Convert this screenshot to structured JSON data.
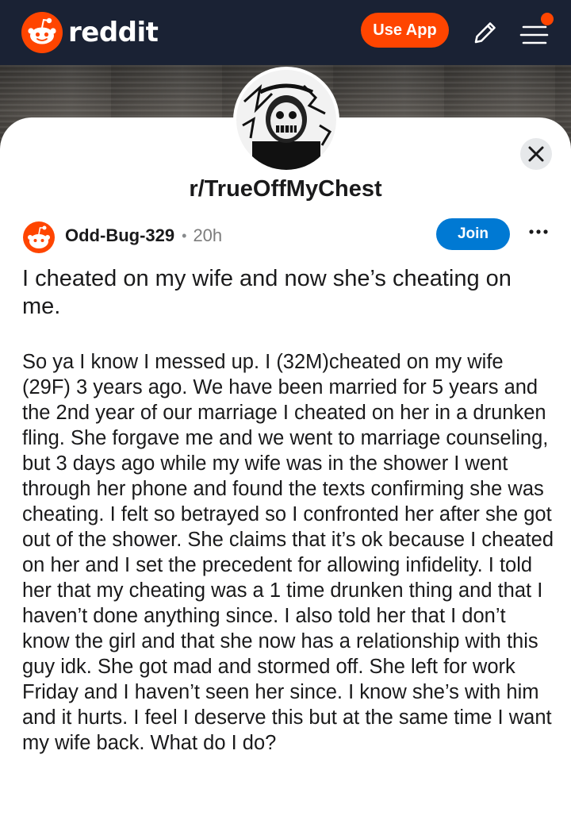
{
  "header": {
    "logo_text": "reddit",
    "use_app_label": "Use App",
    "brand_color": "#ff4500",
    "bar_color": "#1a2234",
    "icons": [
      "reddit-snoo-icon",
      "pencil-icon",
      "menu-icon",
      "notification-dot-icon"
    ]
  },
  "community": {
    "name": "r/TrueOffMyChest",
    "close_icon": "close-icon"
  },
  "post": {
    "author": "Odd-Bug-329",
    "separator": "•",
    "age": "20h",
    "join_label": "Join",
    "join_color": "#0079d3",
    "more_icon": "more-options-icon",
    "title": "I cheated on my wife and now she’s cheating on me.",
    "body": "So ya I know I messed up. I (32M)cheated on my wife (29F) 3 years ago. We have been married for 5 years and the 2nd year of our marriage I cheated on her in a drunken fling. She forgave me and we went to marriage counseling, but 3 days ago while my wife was in the shower I went through her phone and found the texts confirming she was cheating. I felt so betrayed so I confronted her after she got out of the shower. She claims that it’s ok because I cheated on her and I set the precedent for allowing infidelity. I told her that my cheating was a 1 time drunken thing and that I haven’t done anything since. I also told her that I don’t know the girl and that she now has a relationship with this guy idk. She got mad and stormed off. She left for work Friday and I haven’t seen her since. I know she’s with him and it hurts. I feel I deserve this but at the same time I want my wife back. What do I do?"
  }
}
